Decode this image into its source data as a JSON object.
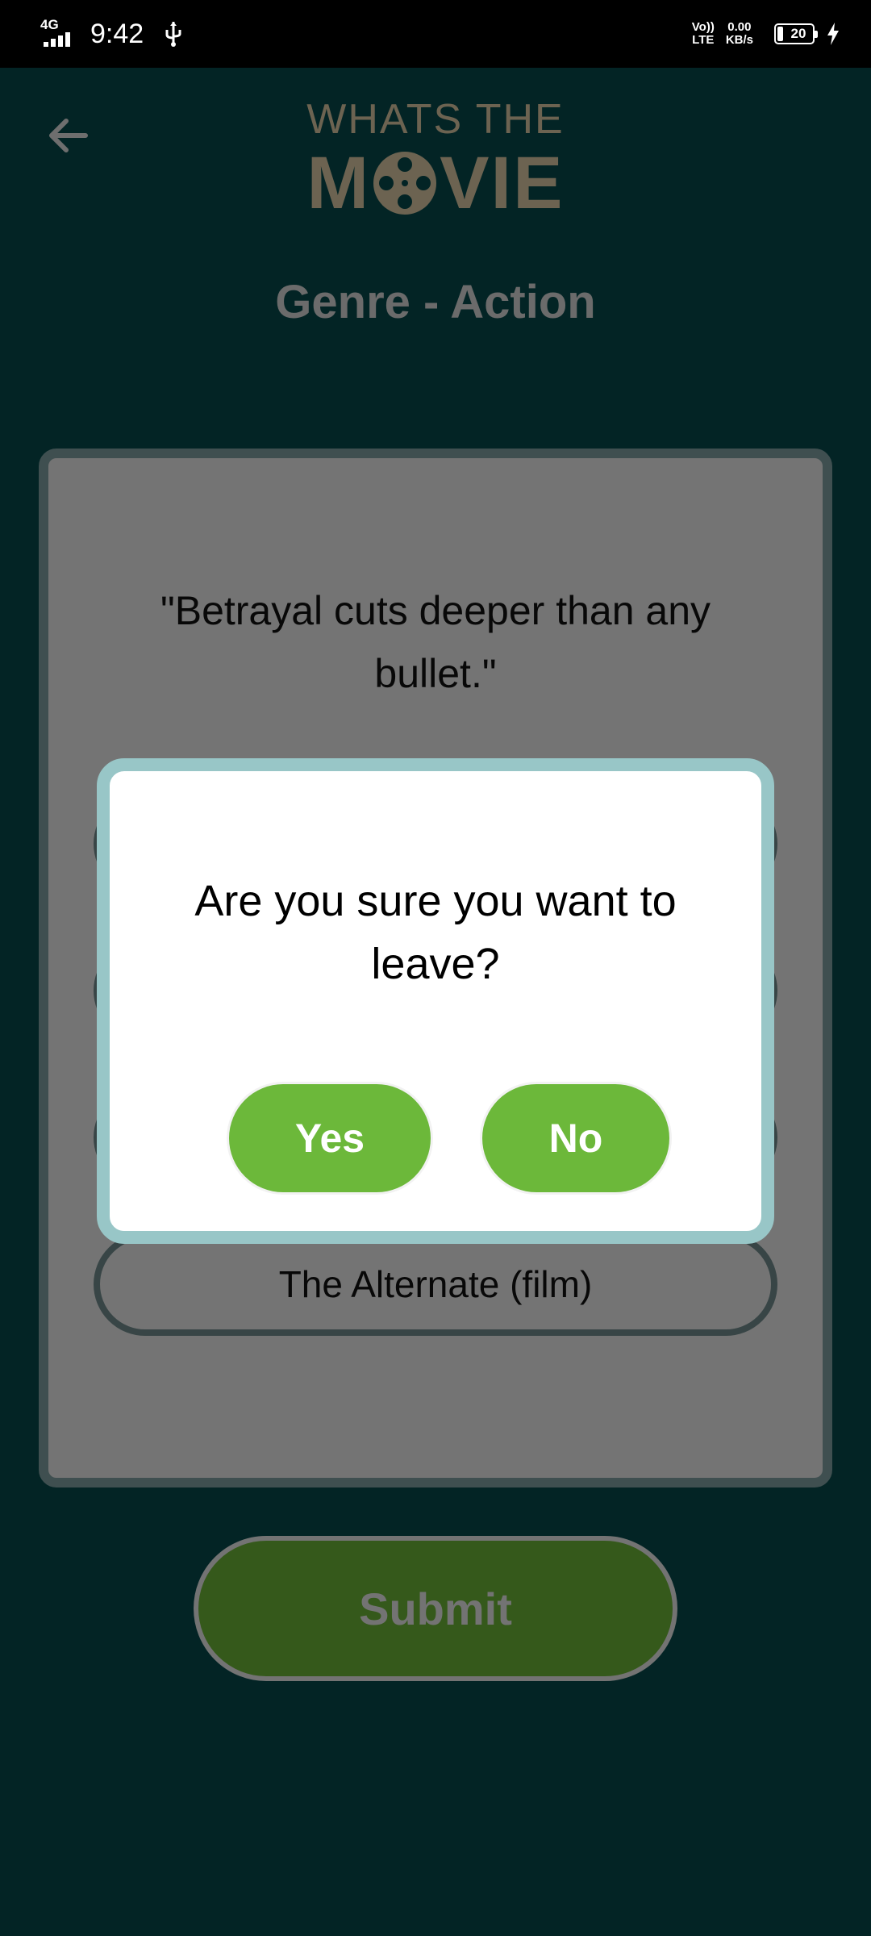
{
  "status_bar": {
    "network": "4G",
    "time": "9:42",
    "volte_top": "Vo))",
    "volte_bottom": "LTE",
    "speed_value": "0.00",
    "speed_unit": "KB/s",
    "battery_level": "20"
  },
  "header": {
    "logo_line1": "WHATS THE",
    "logo_line2_left": "M",
    "logo_line2_right": "VIE",
    "back_icon": "back-arrow-icon"
  },
  "genre_title": "Genre - Action",
  "quiz": {
    "quote": "\"Betrayal cuts deeper than any bullet.\"",
    "options": [
      {
        "label": ""
      },
      {
        "label": ""
      },
      {
        "label": ""
      },
      {
        "label": "The Alternate (film)"
      }
    ]
  },
  "submit_label": "Submit",
  "dialog": {
    "message": "Are you sure you want to leave?",
    "yes_label": "Yes",
    "no_label": "No"
  },
  "colors": {
    "background": "#07494a",
    "logo": "#d8c6a2",
    "card_border": "#7e9fa0",
    "accent_green": "#6cb83a",
    "dialog_border": "#98c6c7"
  }
}
